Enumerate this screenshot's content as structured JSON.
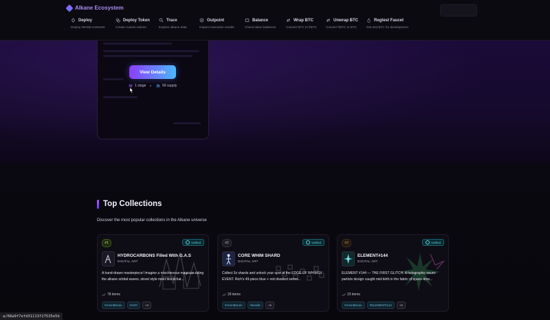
{
  "header": {
    "brand": "Alkane Ecosystem",
    "nav": [
      {
        "icon": "deploy-icon",
        "label": "Deploy",
        "sub": "Deploy WASM contracts"
      },
      {
        "icon": "token-icon",
        "label": "Deploy Token",
        "sub": "Create custom tokens"
      },
      {
        "icon": "search-icon",
        "label": "Trace",
        "sub": "Explore alkane data"
      },
      {
        "icon": "target-icon",
        "label": "Outpoint",
        "sub": "Inspect execution results"
      },
      {
        "icon": "wallet-icon",
        "label": "Balance",
        "sub": "Check token balances"
      },
      {
        "icon": "swap-icon",
        "label": "Wrap BTC",
        "sub": "Convert BTC to frBTC"
      },
      {
        "icon": "swap-icon",
        "label": "Unwrap BTC",
        "sub": "Convert frBTC to BTC"
      },
      {
        "icon": "faucet-icon",
        "label": "Regtest Faucet",
        "sub": "Get test BTC for development"
      }
    ]
  },
  "hero_card": {
    "button": "View Details",
    "stage": "1 stage",
    "supply": "69 supply"
  },
  "top_collections": {
    "title": "Top Collections",
    "description": "Discover the most popular collections in the Alkane universe",
    "cards": [
      {
        "rank": "#1",
        "verified": "Verified",
        "name": "HYDROCARBONS Filled With G.A.S",
        "category": "DIGITAL ART",
        "description": "A hand-drawn masterpiece! Imagine a mischievous magician riding the alkane orbital waves, street style meet blockchai...",
        "items": "78 items",
        "tags": [
          "#ArtonBitcoin",
          "#ArtFi"
        ],
        "more": "+4"
      },
      {
        "rank": "#2",
        "verified": "Verified",
        "name": "CORE WHIM SHARD",
        "category": "DIGITAL ART",
        "description": "Collect 3x shards and unlock your spot at the EDGE OF WHIMSY EVENT. Rich's 49-piece blue + red doodled series...",
        "items": "29 items",
        "tags": [
          "#ArtonBitcoin",
          "#doodle"
        ],
        "more": "+4"
      },
      {
        "rank": "#3",
        "verified": "Verified",
        "name": "ELEMENT#144",
        "category": "DIGITAL ART",
        "description": "ELEMENT #144 — THE FIRST GLITCH. A holographic neuro-particle design caught mid-birth in the fabric of space-time...",
        "items": "23 items",
        "tags": [
          "#ArtonBitcoin",
          "#ELEMENT#144"
        ],
        "more": "+4"
      }
    ]
  },
  "statusbar": {
    "text": "a/68a9f7efd31113f27535e5b"
  },
  "colors": {
    "accent_purple": "#8a3dff",
    "accent_blue": "#4cb8ff",
    "verified": "#5fd0e0",
    "background": "#07060b"
  }
}
